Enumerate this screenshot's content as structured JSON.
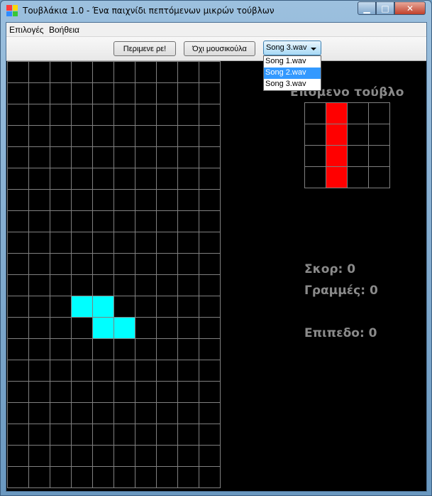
{
  "window": {
    "title": "Τουβλάκια 1.0 - Ένα παιχνίδι πεπτόμενων μικρών τούβλων",
    "controls": {
      "minimize": "▁",
      "maximize": "□",
      "close": "✕"
    }
  },
  "menubar": {
    "items": [
      "Επιλογές",
      "Βοήθεια"
    ]
  },
  "toolbar": {
    "pause_label": "Περιμενε ρε!",
    "music_label": "Όχι μουσικούλα",
    "song_selected": "Song 3.wav",
    "song_options": [
      "Song 1.wav",
      "Song 2.wav",
      "Song 3.wav"
    ],
    "song_highlighted": "Song 2.wav"
  },
  "board": {
    "columns": 10,
    "rows": 20,
    "falling_piece": {
      "color": "#00ffff",
      "cells": [
        [
          3,
          11
        ],
        [
          4,
          11
        ],
        [
          4,
          12
        ],
        [
          5,
          12
        ]
      ]
    }
  },
  "next_piece": {
    "label": "Επομενο τούβλο",
    "color": "#ff0000",
    "cells": [
      [
        1,
        0
      ],
      [
        1,
        1
      ],
      [
        1,
        2
      ],
      [
        1,
        3
      ]
    ]
  },
  "stats": {
    "score": "Σκορ: 0",
    "lines": "Γραμμές: 0",
    "level": "Επιπεδο: 0"
  },
  "colors": {
    "grid": "#808080",
    "background": "#000000",
    "text": "#8a8a8a",
    "selection": "#3399ff"
  },
  "icons": {
    "app_icon": "colored-blocks-icon",
    "combo_arrow": "chevron-down-icon"
  }
}
